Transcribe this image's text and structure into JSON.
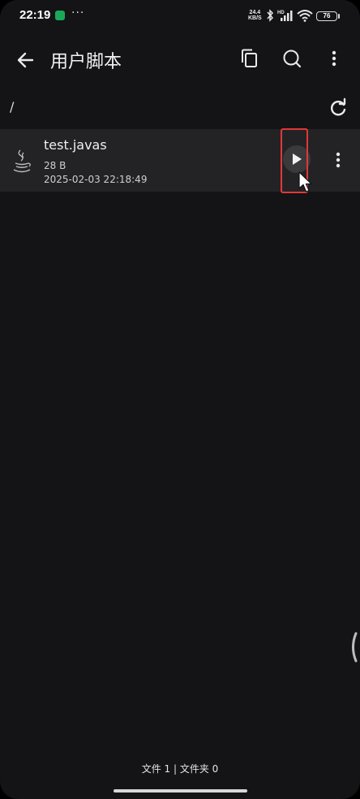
{
  "status_bar": {
    "time": "22:19",
    "more": "···",
    "net_speed_value": "24.4",
    "net_speed_unit": "KB/S",
    "battery": "76"
  },
  "app_bar": {
    "title": "用户脚本"
  },
  "path": "/",
  "files": [
    {
      "name": "test.javas",
      "size": "28 B",
      "modified": "2025-02-03 22:18:49"
    }
  ],
  "footer": {
    "summary": "文件 1 | 文件夹 0"
  },
  "colors": {
    "background": "#141416",
    "row_background": "#232326",
    "highlight_box": "#e23838",
    "status_app_icon": "#1aa85a"
  },
  "icons": [
    "back-arrow-icon",
    "copy-icon",
    "search-icon",
    "more-vertical-icon",
    "refresh-icon",
    "java-file-icon",
    "play-icon",
    "mouse-cursor-icon"
  ]
}
